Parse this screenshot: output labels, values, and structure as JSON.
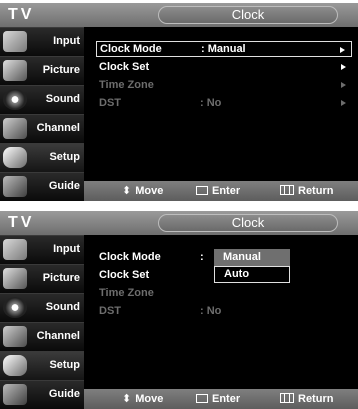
{
  "header": {
    "brand": "TV",
    "title": "Clock"
  },
  "sidebar": {
    "items": [
      {
        "label": "Input",
        "icon": "input-icon"
      },
      {
        "label": "Picture",
        "icon": "picture-icon"
      },
      {
        "label": "Sound",
        "icon": "sound-icon"
      },
      {
        "label": "Channel",
        "icon": "channel-icon"
      },
      {
        "label": "Setup",
        "icon": "setup-icon"
      },
      {
        "label": "Guide",
        "icon": "guide-icon"
      }
    ],
    "active": "Setup"
  },
  "menu": {
    "rows": [
      {
        "label": "Clock Mode",
        "value": ": Manual",
        "enabled": true
      },
      {
        "label": "Clock Set",
        "value": "",
        "enabled": true
      },
      {
        "label": "Time Zone",
        "value": "",
        "enabled": false
      },
      {
        "label": "DST",
        "value": ": No",
        "enabled": false
      }
    ]
  },
  "screen2": {
    "clock_mode_colon": ":",
    "dst_value": ": No",
    "dropdown": {
      "options": [
        "Manual",
        "Auto"
      ],
      "selected": "Manual",
      "highlighted": "Auto"
    }
  },
  "footer": {
    "move": "Move",
    "enter": "Enter",
    "return": "Return"
  },
  "colors": {
    "background": "#3a3a3a",
    "panel": "#000000",
    "header": "#8a8a8a",
    "dim_text": "#6d6d6d"
  }
}
